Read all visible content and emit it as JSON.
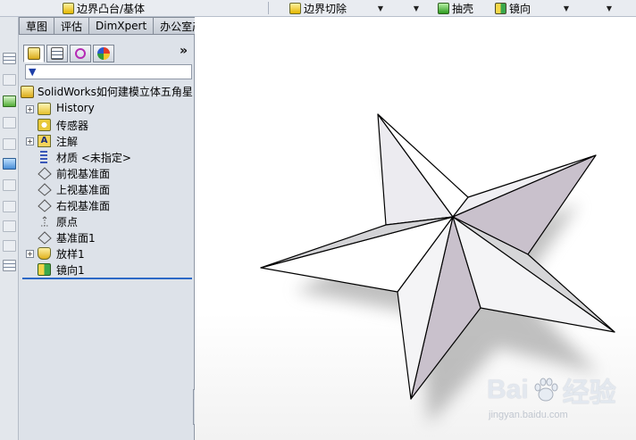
{
  "toolbar": {
    "boundary_boss": "边界凸台/基体",
    "boundary_cut": "边界切除",
    "shell": "抽壳",
    "mirror": "镜向",
    "dropdown_glyph": "▼"
  },
  "command_tabs": [
    {
      "label": "草图"
    },
    {
      "label": "评估"
    },
    {
      "label": "DimXpert"
    },
    {
      "label": "办公室产品"
    }
  ],
  "panel": {
    "more_glyph": "»",
    "filter_glyph": "▼"
  },
  "tree": {
    "root": "SolidWorks如何建模立体五角星",
    "items": [
      {
        "label": "History",
        "icon": "history-icon",
        "expandable": true
      },
      {
        "label": "传感器",
        "icon": "sensor-icon",
        "expandable": false
      },
      {
        "label": "注解",
        "icon": "annotation-icon",
        "expandable": true
      },
      {
        "label": "材质 <未指定>",
        "icon": "material-icon",
        "expandable": false
      },
      {
        "label": "前视基准面",
        "icon": "plane-icon",
        "expandable": false
      },
      {
        "label": "上视基准面",
        "icon": "plane-icon",
        "expandable": false
      },
      {
        "label": "右视基准面",
        "icon": "plane-icon",
        "expandable": false
      },
      {
        "label": "原点",
        "icon": "origin-icon",
        "expandable": false
      },
      {
        "label": "基准面1",
        "icon": "plane-icon",
        "expandable": false
      },
      {
        "label": "放样1",
        "icon": "loft-icon",
        "expandable": true
      },
      {
        "label": "镜向1",
        "icon": "mirror-icon",
        "expandable": false
      }
    ]
  },
  "watermark": {
    "brand": "Bai",
    "brand_tail": "经验",
    "url": "jingyan.baidu.com"
  },
  "colors": {
    "face_light": "#ecebf0",
    "face_grey": "#d3d3d6",
    "face_mauve": "#c9c1cc",
    "selection_line": "#2c68c6"
  }
}
